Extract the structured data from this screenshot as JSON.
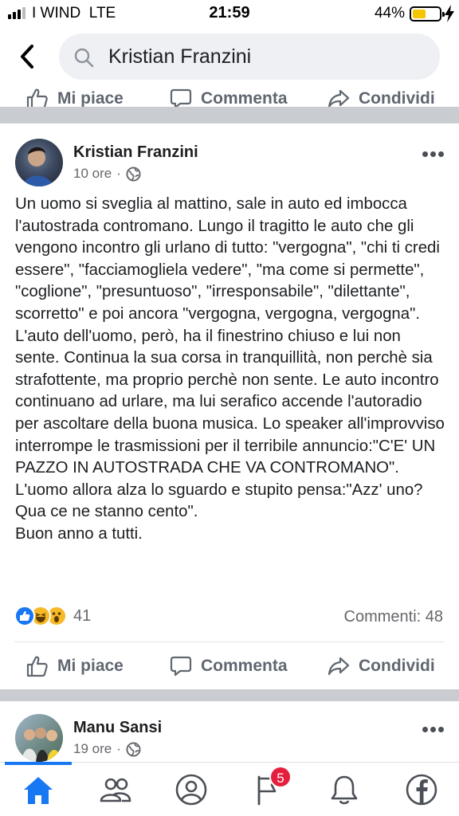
{
  "status_bar": {
    "carrier": "I WIND",
    "network": "LTE",
    "time": "21:59",
    "battery_percent": "44%",
    "battery_level": 0.44,
    "signal_bars": 3
  },
  "search": {
    "query": "Kristian Franzini"
  },
  "actions_labels": {
    "like": "Mi piace",
    "comment": "Commenta",
    "share": "Condividi"
  },
  "post": {
    "author": "Kristian Franzini",
    "time": "10 ore",
    "separator": "·",
    "privacy_icon": "globe-icon",
    "text": "Un uomo si sveglia al mattino, sale in auto ed imbocca l'autostrada contromano. Lungo il tragitto le auto che gli vengono incontro gli urlano di tutto: \"vergogna\", \"chi ti credi essere\", \"facciamogliela vedere\", \"ma come si permette\", \"coglione\", \"presuntuoso\", \"irresponsabile\", \"dilettante\", scorretto\" e poi ancora \"vergogna, vergogna, vergogna\". L'auto dell'uomo, però, ha il finestrino chiuso e lui non sente. Continua la sua corsa in tranquillità, non perchè sia strafottente, ma proprio perchè non sente. Le auto incontro continuano ad urlare, ma lui serafico accende l'autoradio per ascoltare della buona musica. Lo speaker all'improvviso interrompe le trasmissioni per il terribile annuncio:\"C'E' UN PAZZO IN AUTOSTRADA CHE VA CONTROMANO\". L'uomo allora alza lo sguardo e stupito pensa:\"Azz' uno? Qua ce ne stanno cento\".\nBuon anno a tutti.",
    "reactions": [
      "like",
      "haha",
      "wow"
    ],
    "reaction_count": "41",
    "comments": "Commenti: 48"
  },
  "next_post": {
    "author": "Manu Sansi",
    "time": "19 ore",
    "separator": "·"
  },
  "tabbar": {
    "items": [
      "home-icon",
      "friends-icon",
      "profile-icon",
      "pages-icon",
      "notifications-icon",
      "facebook-icon"
    ],
    "pages_badge": "5",
    "active": "home",
    "accent": "#1877f2"
  }
}
